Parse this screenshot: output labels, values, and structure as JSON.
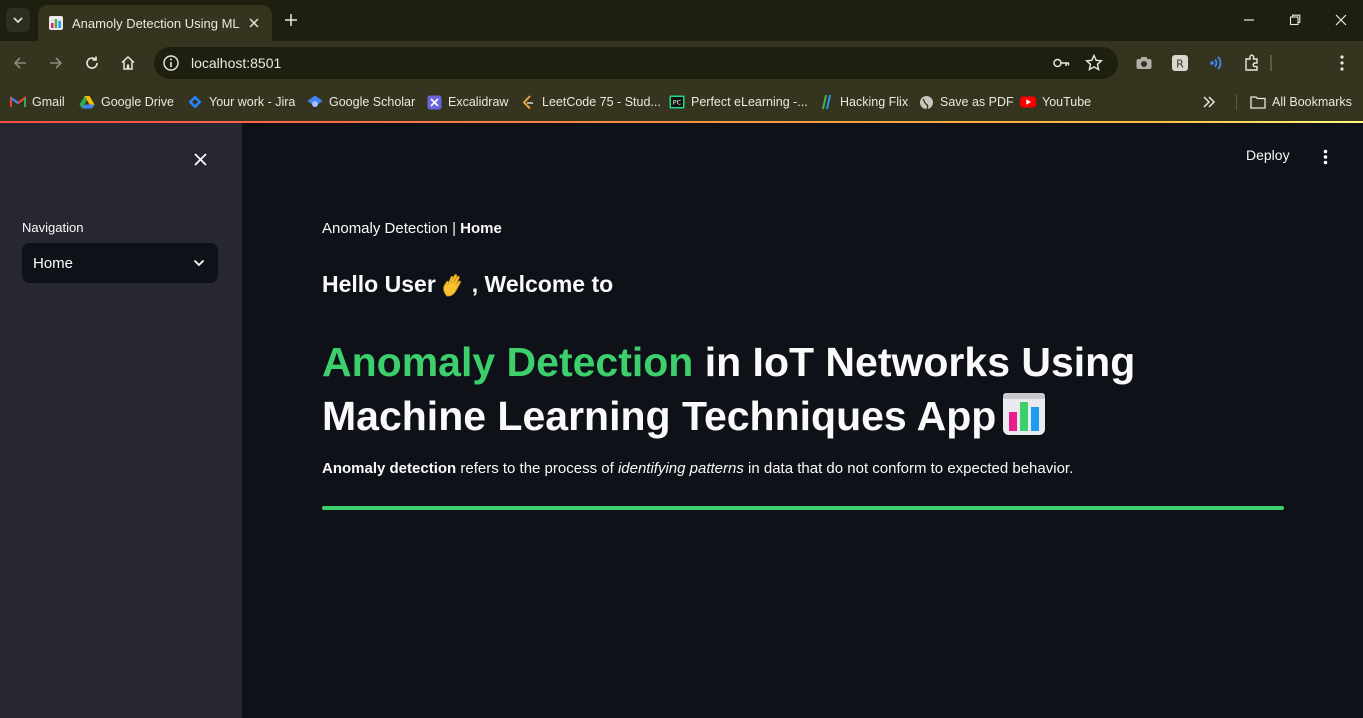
{
  "browser": {
    "tab_title": "Anamoly Detection Using ML",
    "url": "localhost:8501",
    "bookmarks": [
      {
        "label": "Gmail",
        "icon": "gmail-icon"
      },
      {
        "label": "Google Drive",
        "icon": "drive-icon"
      },
      {
        "label": "Your work - Jira",
        "icon": "jira-icon"
      },
      {
        "label": "Google Scholar",
        "icon": "scholar-icon"
      },
      {
        "label": "Excalidraw",
        "icon": "excalidraw-icon"
      },
      {
        "label": "LeetCode 75 - Stud...",
        "icon": "leetcode-icon"
      },
      {
        "label": "Perfect eLearning -...",
        "icon": "pc-icon"
      },
      {
        "label": "Hacking Flix",
        "icon": "flix-icon"
      },
      {
        "label": "Save as PDF",
        "icon": "globe-icon"
      },
      {
        "label": "YouTube",
        "icon": "youtube-icon"
      }
    ],
    "all_bookmarks": "All Bookmarks"
  },
  "sidebar": {
    "nav_label": "Navigation",
    "selected": "Home"
  },
  "header": {
    "deploy": "Deploy"
  },
  "content": {
    "breadcrumb_prefix": "Anomaly Detection | ",
    "breadcrumb_current": "Home",
    "greeting_start": "Hello User",
    "greeting_end": ", Welcome to",
    "title_accent": "Anomaly Detection",
    "title_rest": " in IoT Networks Using Machine Learning Techniques App",
    "desc_bold": "Anomaly detection",
    "desc_mid": " refers to the process of ",
    "desc_italic": "identifying patterns",
    "desc_end": " in data that do not conform to expected behavior."
  },
  "colors": {
    "accent": "#3ccf6c",
    "background": "#0e1117",
    "sidebar": "#262730"
  }
}
